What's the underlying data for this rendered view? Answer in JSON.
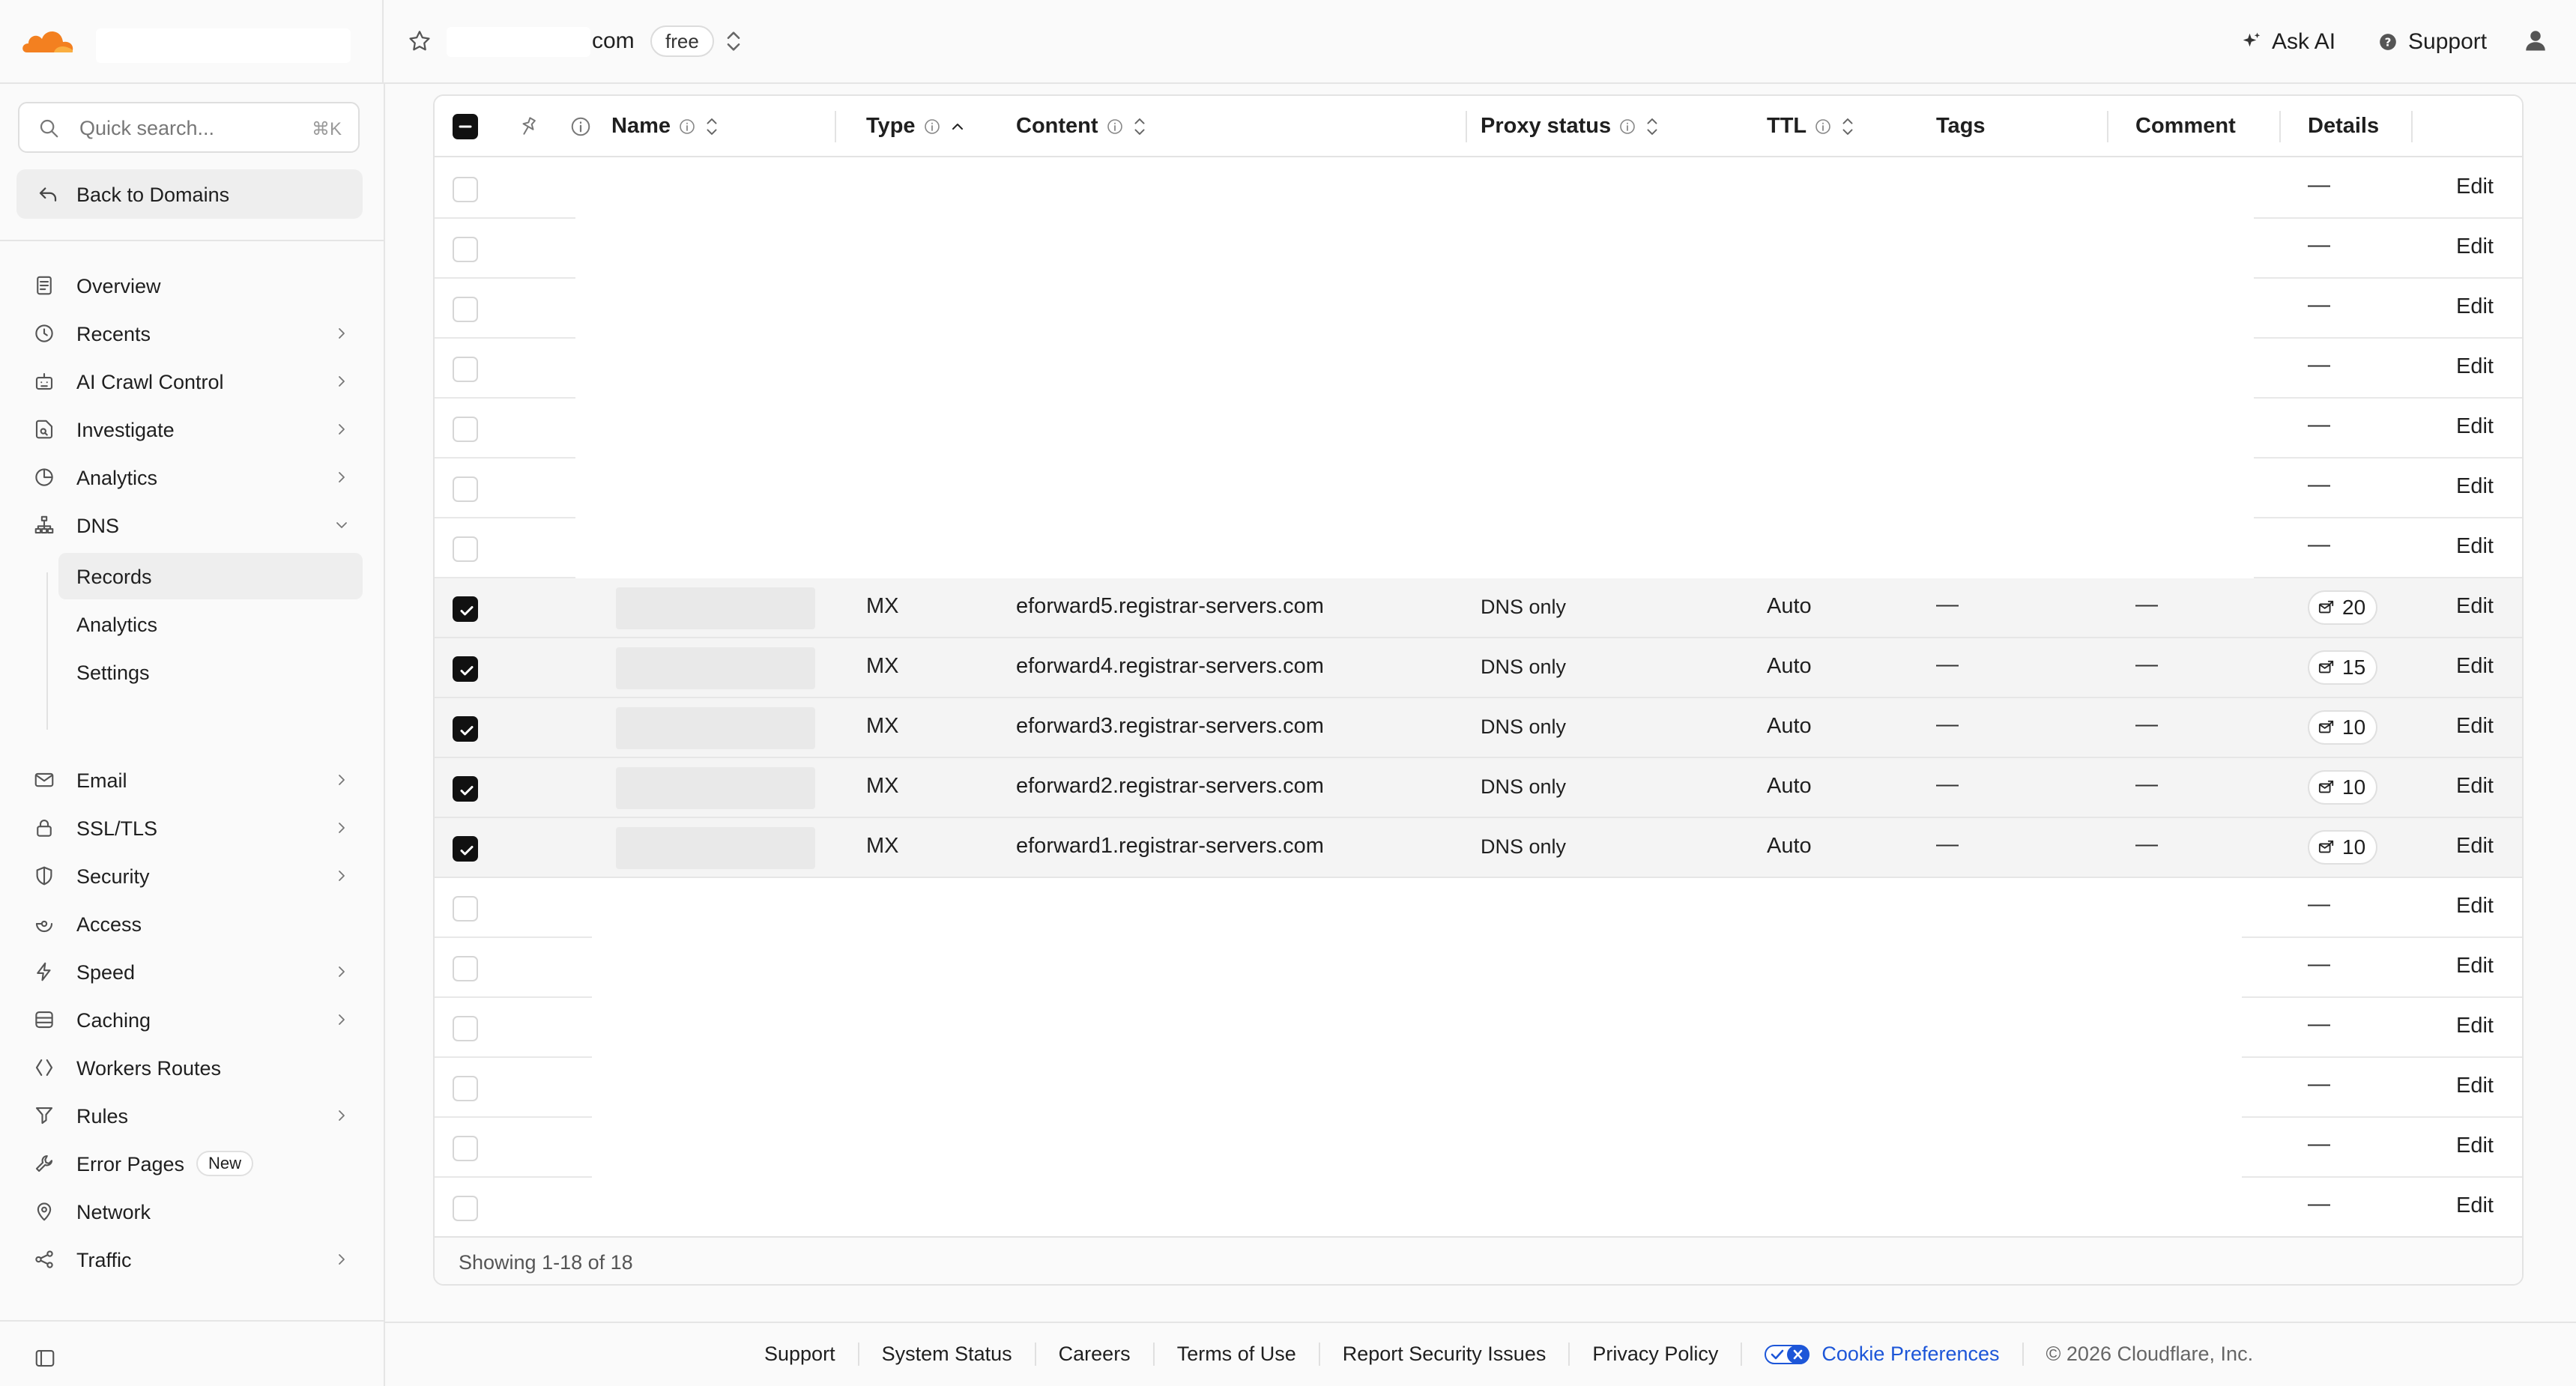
{
  "header": {
    "domain_suffix": "com",
    "plan": "free",
    "ask_ai": "Ask AI",
    "support": "Support"
  },
  "sidebar": {
    "search_placeholder": "Quick search...",
    "search_shortcut": "⌘K",
    "back": "Back to Domains",
    "items": [
      {
        "label": "Overview",
        "icon": "document-icon",
        "chevron": false
      },
      {
        "label": "Recents",
        "icon": "clock-icon",
        "chevron": true
      },
      {
        "label": "AI Crawl Control",
        "icon": "robot-icon",
        "chevron": true
      },
      {
        "label": "Investigate",
        "icon": "file-search-icon",
        "chevron": true
      },
      {
        "label": "Analytics",
        "icon": "pie-chart-icon",
        "chevron": true
      },
      {
        "label": "DNS",
        "icon": "sitemap-icon",
        "chevron": "down"
      }
    ],
    "dns_sub": [
      {
        "label": "Records",
        "active": true
      },
      {
        "label": "Analytics",
        "active": false
      },
      {
        "label": "Settings",
        "active": false
      }
    ],
    "items_after": [
      {
        "label": "Email",
        "icon": "mail-icon",
        "chevron": true
      },
      {
        "label": "SSL/TLS",
        "icon": "lock-icon",
        "chevron": true
      },
      {
        "label": "Security",
        "icon": "shield-icon",
        "chevron": true
      },
      {
        "label": "Access",
        "icon": "access-icon",
        "chevron": false
      },
      {
        "label": "Speed",
        "icon": "bolt-icon",
        "chevron": true
      },
      {
        "label": "Caching",
        "icon": "database-icon",
        "chevron": true
      },
      {
        "label": "Workers Routes",
        "icon": "workers-icon",
        "chevron": false
      },
      {
        "label": "Rules",
        "icon": "funnel-icon",
        "chevron": true
      },
      {
        "label": "Error Pages",
        "icon": "wrench-icon",
        "chevron": false,
        "badge": "New"
      },
      {
        "label": "Network",
        "icon": "pin-icon",
        "chevron": false
      },
      {
        "label": "Traffic",
        "icon": "share-icon",
        "chevron": true
      }
    ]
  },
  "table": {
    "columns": {
      "name": "Name",
      "type": "Type",
      "content": "Content",
      "proxy": "Proxy status",
      "ttl": "TTL",
      "tags": "Tags",
      "comment": "Comment",
      "details": "Details"
    },
    "dash": "—",
    "edit": "Edit",
    "selected_rows": [
      {
        "type": "MX",
        "content": "eforward5.registrar-servers.com",
        "proxy": "DNS only",
        "ttl": "Auto",
        "priority": "20"
      },
      {
        "type": "MX",
        "content": "eforward4.registrar-servers.com",
        "proxy": "DNS only",
        "ttl": "Auto",
        "priority": "15"
      },
      {
        "type": "MX",
        "content": "eforward3.registrar-servers.com",
        "proxy": "DNS only",
        "ttl": "Auto",
        "priority": "10"
      },
      {
        "type": "MX",
        "content": "eforward2.registrar-servers.com",
        "proxy": "DNS only",
        "ttl": "Auto",
        "priority": "10"
      },
      {
        "type": "MX",
        "content": "eforward1.registrar-servers.com",
        "proxy": "DNS only",
        "ttl": "Auto",
        "priority": "10"
      }
    ],
    "showing": "Showing 1-18 of 18"
  },
  "footer": {
    "links": [
      "Support",
      "System Status",
      "Careers",
      "Terms of Use",
      "Report Security Issues",
      "Privacy Policy"
    ],
    "cookie": "Cookie Preferences",
    "copyright": "© 2026 Cloudflare, Inc."
  },
  "colors": {
    "brand_orange": "#f38020",
    "link_blue": "#1d56d8"
  }
}
